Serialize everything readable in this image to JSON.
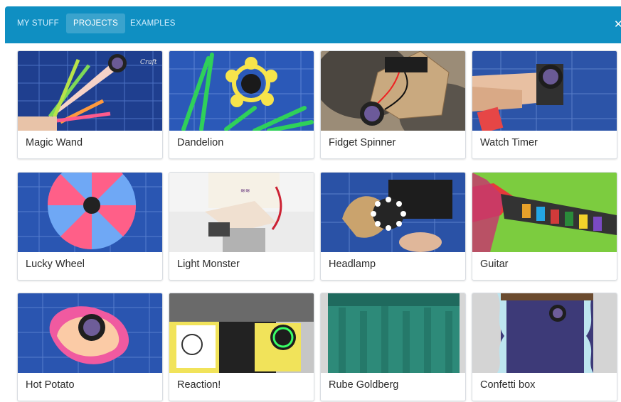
{
  "tabs": [
    {
      "label": "MY STUFF"
    },
    {
      "label": "PROJECTS"
    },
    {
      "label": "EXAMPLES"
    }
  ],
  "header": {
    "accent_color": "#0f8fc2",
    "close_icon": "close-icon"
  },
  "cards": [
    {
      "label": "Magic Wand"
    },
    {
      "label": "Dandelion"
    },
    {
      "label": "Fidget Spinner"
    },
    {
      "label": "Watch Timer"
    },
    {
      "label": "Lucky Wheel"
    },
    {
      "label": "Light Monster"
    },
    {
      "label": "Headlamp"
    },
    {
      "label": "Guitar"
    },
    {
      "label": "Hot Potato"
    },
    {
      "label": "Reaction!"
    },
    {
      "label": "Rube Goldberg"
    },
    {
      "label": "Confetti box"
    }
  ]
}
